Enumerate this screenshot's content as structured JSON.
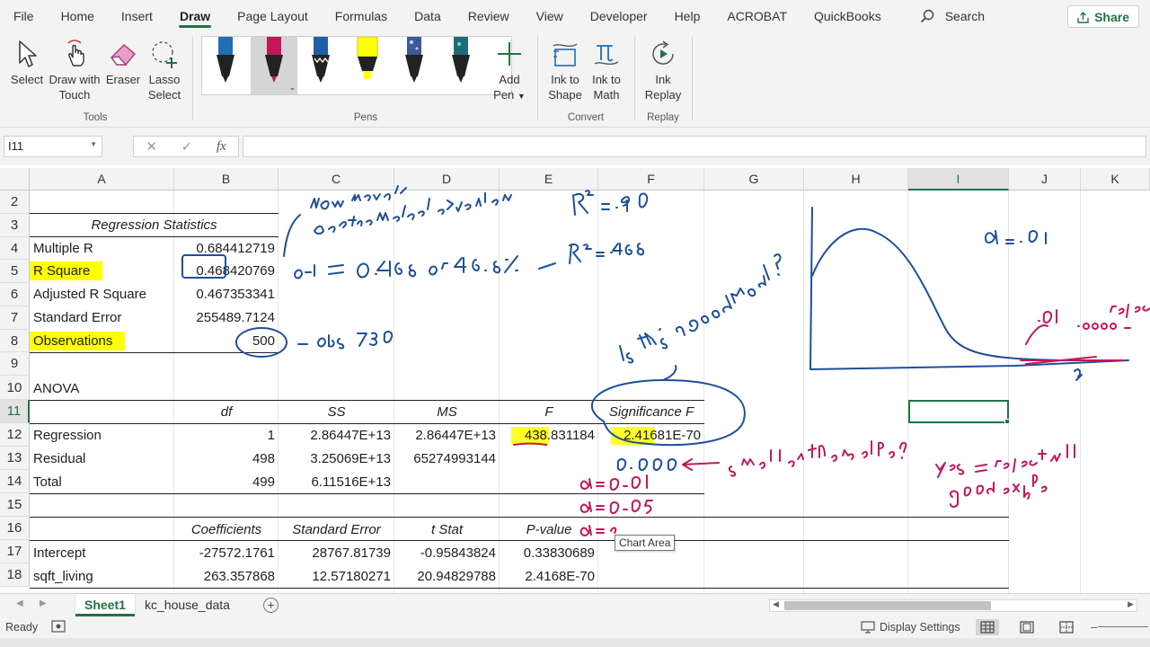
{
  "ribbon_tabs": [
    "File",
    "Home",
    "Insert",
    "Draw",
    "Page Layout",
    "Formulas",
    "Data",
    "Review",
    "View",
    "Developer",
    "Help",
    "ACROBAT",
    "QuickBooks"
  ],
  "active_tab": "Draw",
  "search_label": "Search",
  "share_label": "Share",
  "groups": {
    "tools": {
      "label": "Tools",
      "select": "Select",
      "draw_touch_1": "Draw with",
      "draw_touch_2": "Touch",
      "eraser": "Eraser",
      "lasso_1": "Lasso",
      "lasso_2": "Select"
    },
    "pens": {
      "label": "Pens",
      "add_pen_1": "Add",
      "add_pen_2": "Pen",
      "pen_colors": [
        "#1f6fb5",
        "#c2185b",
        "#1f5fa8",
        "#ffff00",
        "#3b5a9a",
        "#1f6b7b"
      ]
    },
    "convert": {
      "label": "Convert",
      "ink_shape_1": "Ink to",
      "ink_shape_2": "Shape",
      "ink_math_1": "Ink to",
      "ink_math_2": "Math"
    },
    "replay": {
      "label": "Replay",
      "ink_replay_1": "Ink",
      "ink_replay_2": "Replay"
    }
  },
  "name_box": "I11",
  "fx_label": "fx",
  "columns": [
    "A",
    "B",
    "C",
    "D",
    "E",
    "F",
    "G",
    "H",
    "I",
    "J",
    "K"
  ],
  "selected_column": "I",
  "rows": [
    "2",
    "3",
    "4",
    "5",
    "6",
    "7",
    "8",
    "9",
    "10",
    "11",
    "12",
    "13",
    "14",
    "15",
    "16",
    "17",
    "18"
  ],
  "regression_stats": {
    "title": "Regression Statistics",
    "multiple_r_label": "Multiple R",
    "multiple_r": "0.684412719",
    "r_square_label": "R Square",
    "r_square": "0.468420769",
    "adj_r_label": "Adjusted R Square",
    "adj_r": "0.467353341",
    "std_err_label": "Standard Error",
    "std_err": "255489.7124",
    "obs_label": "Observations",
    "obs": "500"
  },
  "anova": {
    "title": "ANOVA",
    "headers": [
      "df",
      "SS",
      "MS",
      "F",
      "Significance F"
    ],
    "regression": [
      "Regression",
      "1",
      "2.86447E+13",
      "2.86447E+13",
      "438.831184",
      "2.41681E-70"
    ],
    "residual": [
      "Residual",
      "498",
      "3.25069E+13",
      "65274993144"
    ],
    "total": [
      "Total",
      "499",
      "6.11516E+13"
    ]
  },
  "coefficients": {
    "headers": [
      "Coefficients",
      "Standard Error",
      "t Stat",
      "P-value"
    ],
    "intercept": [
      "Intercept",
      "-27572.1761",
      "28767.81739",
      "-0.95843824",
      "0.33830689"
    ],
    "sqft": [
      "sqft_living",
      "263.357868",
      "12.57180271",
      "20.94829788",
      "2.4168E-70"
    ]
  },
  "highlight_color": "#ffff00",
  "tooltip": "Chart Area",
  "sheets": [
    "Sheet1",
    "kc_house_data"
  ],
  "active_sheet": "Sheet1",
  "status": {
    "ready": "Ready",
    "display_settings": "Display Settings"
  }
}
